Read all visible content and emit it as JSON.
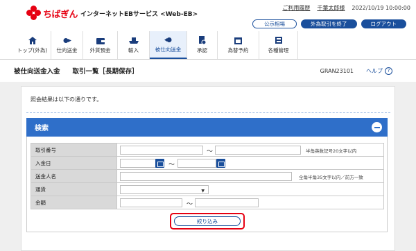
{
  "header": {
    "brand": "ちばぎん",
    "service": "インターネットEBサービス <Web-EB>",
    "usage_history": "ご利用履歴",
    "user_name": "千葉太郎様",
    "datetime": "2022/10/19 10:00:00",
    "buttons": {
      "public_quotes": "公示相場",
      "end_fx": "外為取引を終了",
      "logout": "ログアウト"
    }
  },
  "nav": [
    {
      "label": "トップ(外為)",
      "icon": "home-icon"
    },
    {
      "label": "仕向送金",
      "icon": "send-icon"
    },
    {
      "label": "外貨預金",
      "icon": "wallet-icon"
    },
    {
      "label": "輸入",
      "icon": "import-icon"
    },
    {
      "label": "被仕向送金",
      "icon": "receive-icon",
      "active": true
    },
    {
      "label": "承認",
      "icon": "approve-icon"
    },
    {
      "label": "為替予約",
      "icon": "fx-reserve-icon"
    },
    {
      "label": "各種管理",
      "icon": "settings-icon"
    }
  ],
  "page": {
    "title": "被仕向送金入金",
    "subtitle": "取引一覧［長期保存］",
    "screen_id": "GRAN23101",
    "help": "ヘルプ",
    "help_mark": "?"
  },
  "info_text": "照会結果は以下の通りです。",
  "search": {
    "header": "検索",
    "rows": {
      "torihiki_label": "取引番号",
      "torihiki_hint": "半角英数記号20文字以内",
      "nyukin_label": "入金日",
      "sokin_label": "送金人名",
      "sokin_hint": "全角半角35文字以内／前方一致",
      "tsuka_label": "通貨",
      "kingaku_label": "金額"
    },
    "tilde": "～",
    "submit": "絞り込み"
  },
  "colors": {
    "brand_red": "#e60012",
    "primary_blue": "#1a4f9c",
    "search_header_blue": "#2f6fc9"
  }
}
